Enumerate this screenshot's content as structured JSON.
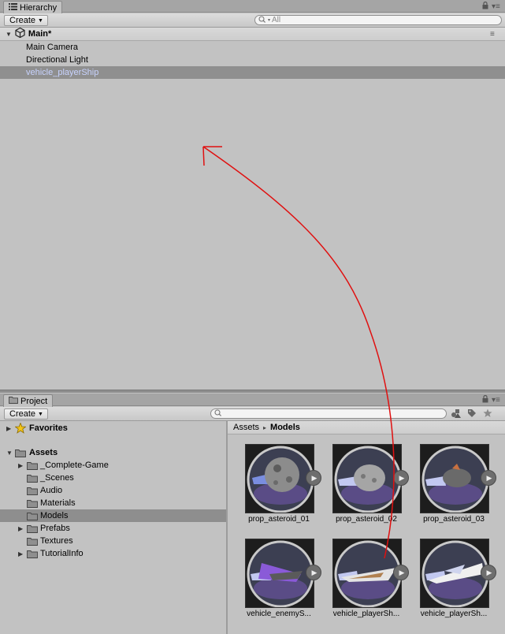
{
  "hierarchy": {
    "tab_label": "Hierarchy",
    "create_label": "Create",
    "search_placeholder": "All",
    "scene_name": "Main*",
    "items": [
      {
        "label": "Main Camera"
      },
      {
        "label": "Directional Light"
      },
      {
        "label": "vehicle_playerShip"
      }
    ]
  },
  "project": {
    "tab_label": "Project",
    "create_label": "Create",
    "search_placeholder": "",
    "tree": {
      "favorites": "Favorites",
      "assets": "Assets",
      "folders": [
        {
          "label": "_Complete-Game",
          "expandable": true
        },
        {
          "label": "_Scenes",
          "expandable": false
        },
        {
          "label": "Audio",
          "expandable": false
        },
        {
          "label": "Materials",
          "expandable": false
        },
        {
          "label": "Models",
          "expandable": false,
          "selected": true
        },
        {
          "label": "Prefabs",
          "expandable": true
        },
        {
          "label": "Textures",
          "expandable": false
        },
        {
          "label": "TutorialInfo",
          "expandable": true
        }
      ]
    },
    "breadcrumb": {
      "root": "Assets",
      "separator": "▸",
      "current": "Models"
    },
    "assets": [
      {
        "label": "prop_asteroid_01"
      },
      {
        "label": "prop_asteroid_02"
      },
      {
        "label": "prop_asteroid_03"
      },
      {
        "label": "vehicle_enemyS..."
      },
      {
        "label": "vehicle_playerSh..."
      },
      {
        "label": "vehicle_playerSh..."
      }
    ]
  },
  "colors": {
    "panel_bg": "#c2c2c2",
    "selection": "#8f8f8f",
    "selected_text": "#c8d3ff",
    "annotation_arrow": "#e01010"
  }
}
